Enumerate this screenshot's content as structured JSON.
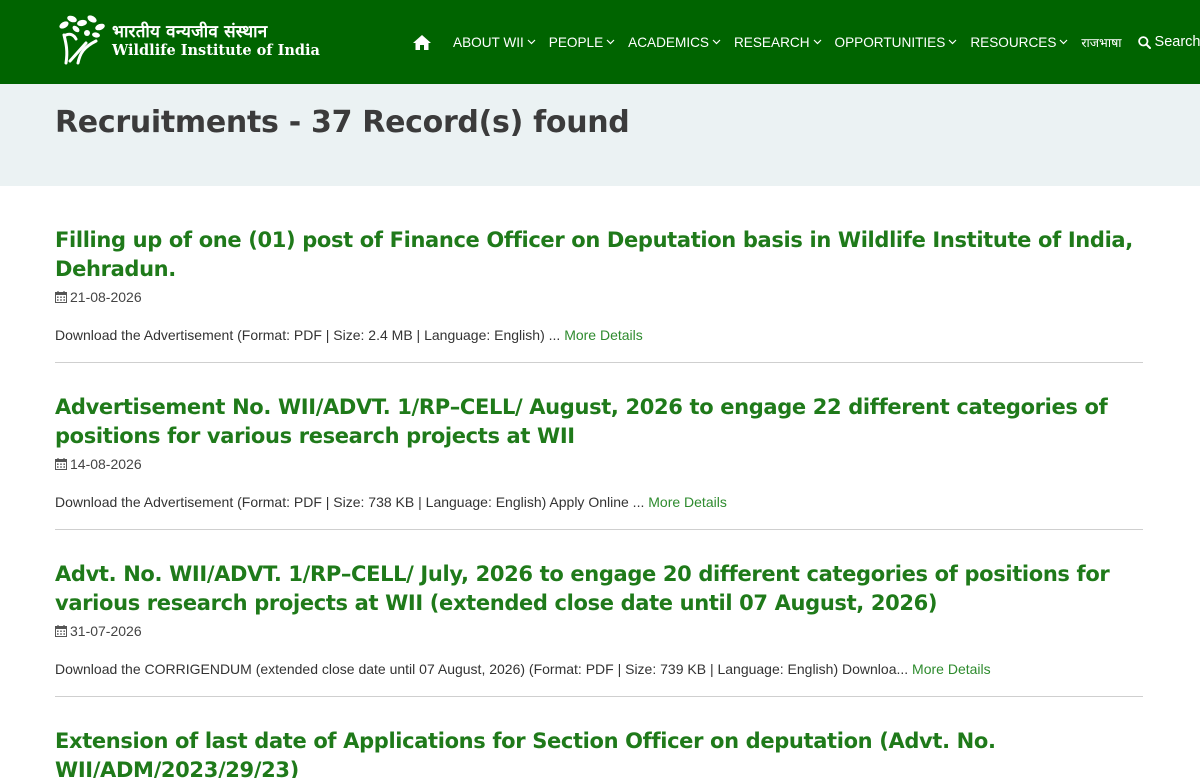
{
  "header": {
    "logo_hindi": "भारतीय वन्यजीव संस्थान",
    "logo_english": "Wildlife Institute of India",
    "nav_items": [
      {
        "label": "ABOUT WII"
      },
      {
        "label": "PEOPLE"
      },
      {
        "label": "ACADEMICS"
      },
      {
        "label": "RESEARCH"
      },
      {
        "label": "OPPORTUNITIES"
      },
      {
        "label": "RESOURCES"
      }
    ],
    "language_label": "राजभाषा",
    "search_label": "Search"
  },
  "banner": {
    "title": "Recruitments - 37 Record(s) found"
  },
  "records": [
    {
      "title": "Filling up of one (01) post of Finance Officer on Deputation basis in Wildlife Institute of India, Dehradun.",
      "date": "21-08-2026",
      "summary": "Download the Advertisement (Format: PDF | Size: 2.4 MB | Language: English) ...",
      "more_label": "More Details"
    },
    {
      "title": "Advertisement No. WII/ADVT. 1/RP–CELL/ August, 2026 to engage 22 different categories of positions for various research projects at WII",
      "date": "14-08-2026",
      "summary": "Download the Advertisement (Format: PDF | Size: 738 KB | Language: English) Apply Online ...",
      "more_label": "More Details"
    },
    {
      "title": "Advt. No. WII/ADVT. 1/RP–CELL/ July, 2026 to engage 20 different categories of positions for various research projects at WII (extended close date until 07 August, 2026)",
      "date": "31-07-2026",
      "summary": "Download the CORRIGENDUM (extended close date until 07 August, 2026) (Format: PDF | Size: 739 KB | Language: English) Downloa...",
      "more_label": "More Details"
    },
    {
      "title": "Extension of last date of Applications for Section Officer on deputation (Advt. No. WII/ADM/2023/29/23)"
    }
  ],
  "colors": {
    "header_bg": "#006400",
    "banner_bg": "#ebf2f3",
    "title_green": "#1f7a1a",
    "link_green": "#2e8b2e"
  }
}
